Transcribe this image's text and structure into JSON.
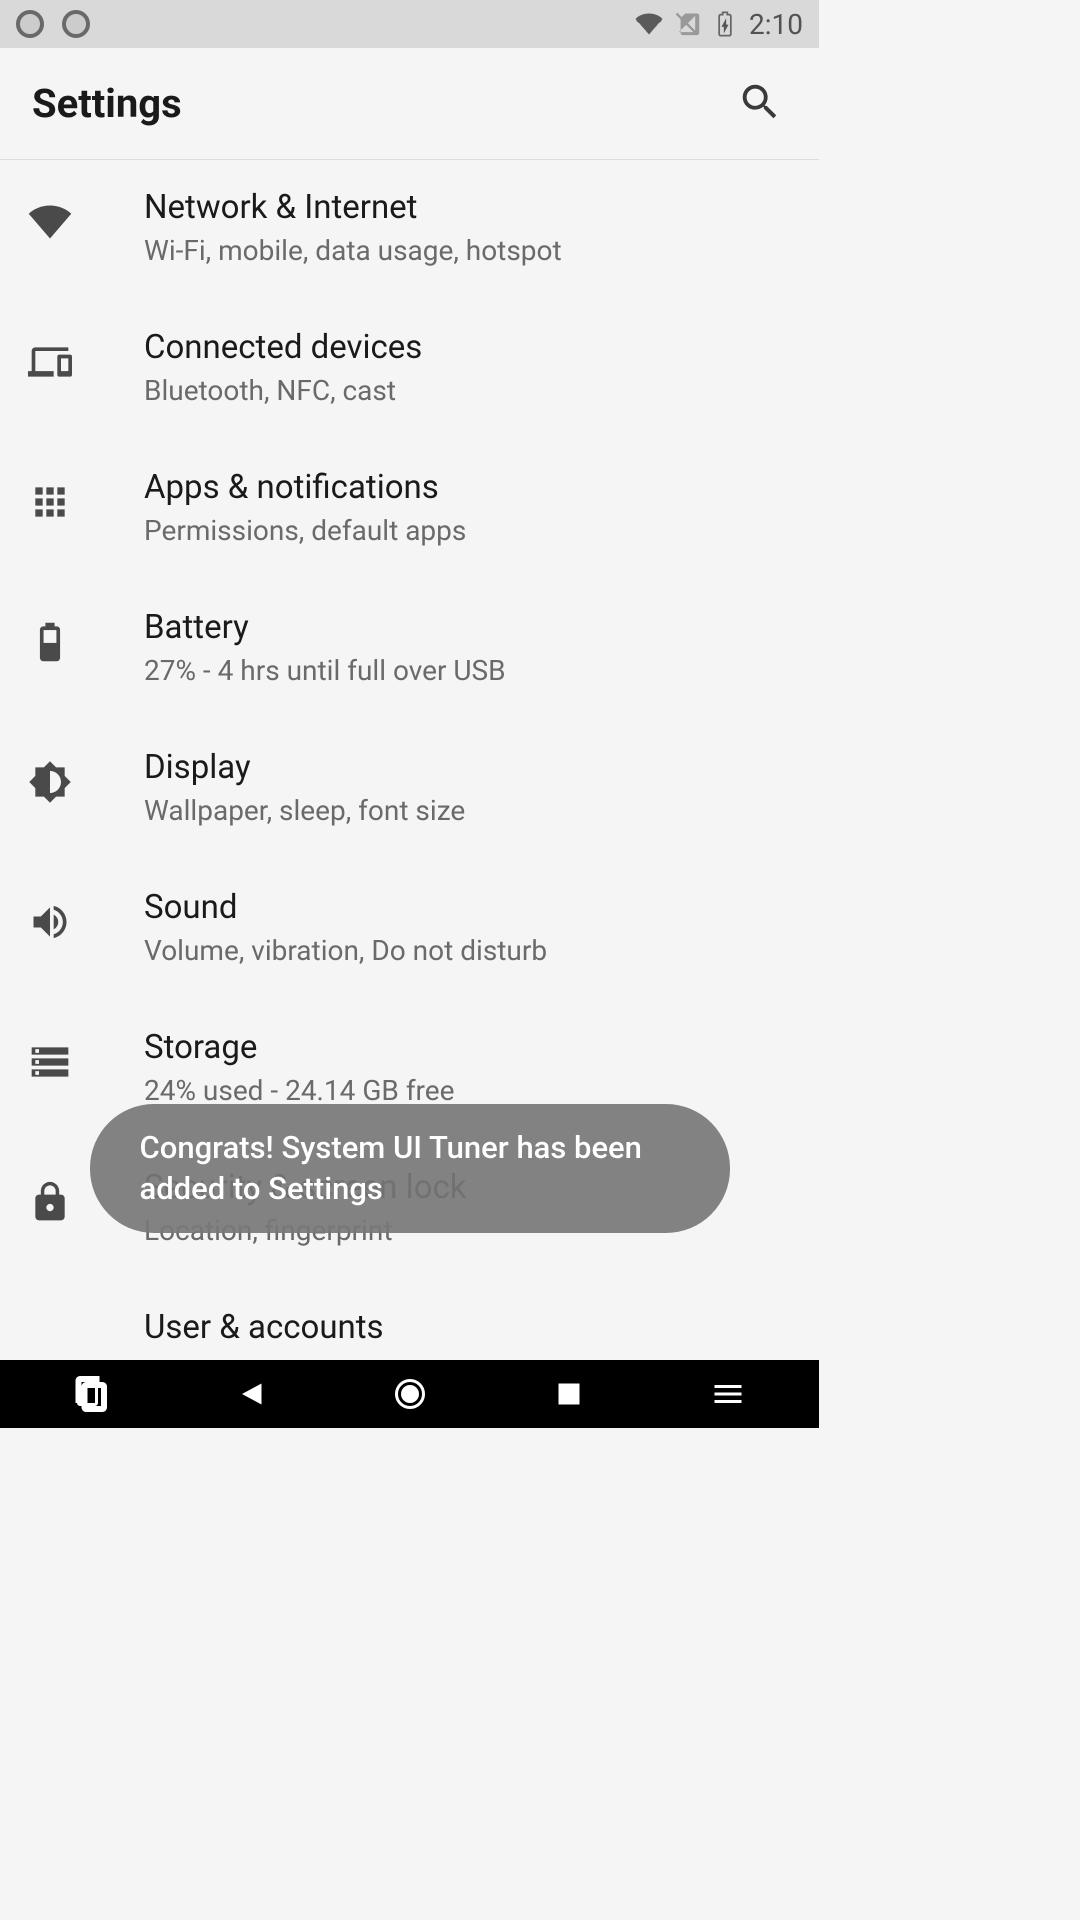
{
  "statusBar": {
    "time": "2:10"
  },
  "appBar": {
    "title": "Settings"
  },
  "items": [
    {
      "title": "Network & Internet",
      "subtitle": "Wi-Fi, mobile, data usage, hotspot"
    },
    {
      "title": "Connected devices",
      "subtitle": "Bluetooth, NFC, cast"
    },
    {
      "title": "Apps & notifications",
      "subtitle": "Permissions, default apps"
    },
    {
      "title": "Battery",
      "subtitle": "27% - 4 hrs until full over USB"
    },
    {
      "title": "Display",
      "subtitle": "Wallpaper, sleep, font size"
    },
    {
      "title": "Sound",
      "subtitle": "Volume, vibration, Do not disturb"
    },
    {
      "title": "Storage",
      "subtitle": "24% used - 24.14 GB free"
    },
    {
      "title": "Security & screen lock",
      "subtitle": "Location, fingerprint"
    },
    {
      "title": "User & accounts",
      "subtitle": ""
    }
  ],
  "toast": {
    "message": "Congrats! System UI Tuner has been added to Settings"
  }
}
